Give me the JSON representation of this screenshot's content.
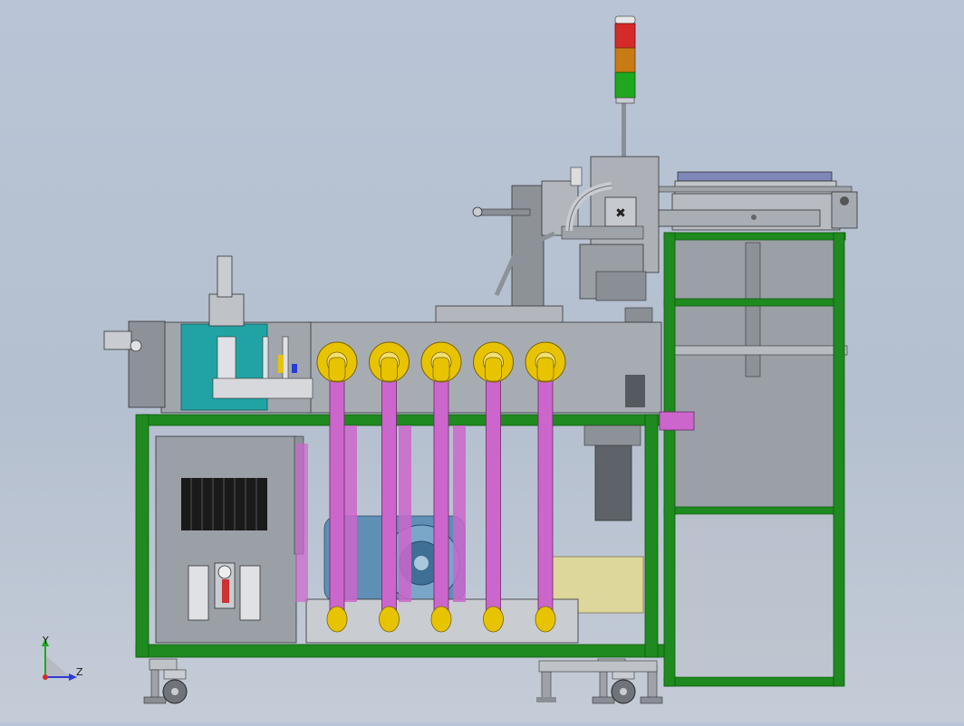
{
  "viewport": {
    "background_top": "#b9c5d6",
    "background_bottom": "#c4ccd7"
  },
  "triad": {
    "y_label": "Y",
    "z_label": "Z",
    "y_color": "#1ea81e",
    "z_color": "#2a3bd6",
    "x_color": "#d42a2a"
  },
  "colors": {
    "frame_green": "#1f8a1f",
    "frame_dark": "#0e5a0e",
    "pipe_magenta": "#cc66cc",
    "flange_yellow": "#e8c400",
    "steel": "#9a9fa6",
    "cabinet_grey": "#8d939b",
    "teal_panel": "#22a3a3",
    "beacon_red": "#d42a2a",
    "beacon_amber": "#c87a14",
    "beacon_green": "#1ea81e"
  },
  "model": {
    "pipe_count": 5,
    "caster_count": 3
  }
}
